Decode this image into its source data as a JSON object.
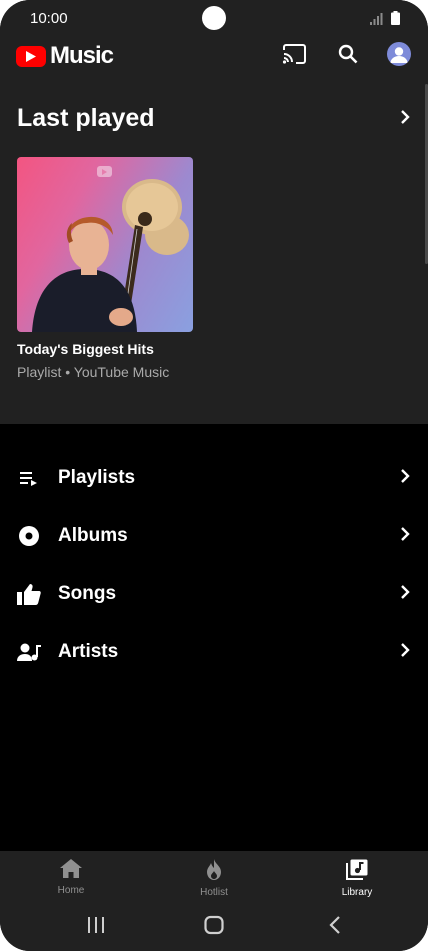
{
  "status_bar": {
    "time": "10:00"
  },
  "app": {
    "name": "Music"
  },
  "last_played": {
    "title": "Last played",
    "card": {
      "title": "Today's Biggest Hits",
      "subtitle": "Playlist • YouTube Music"
    }
  },
  "library": {
    "items": [
      {
        "label": "Playlists",
        "icon": "playlist-icon"
      },
      {
        "label": "Albums",
        "icon": "album-icon"
      },
      {
        "label": "Songs",
        "icon": "thumbs-up-icon"
      },
      {
        "label": "Artists",
        "icon": "artist-icon"
      }
    ]
  },
  "bottom_nav": {
    "items": [
      {
        "label": "Home",
        "icon": "home-icon",
        "active": false
      },
      {
        "label": "Hotlist",
        "icon": "flame-icon",
        "active": false
      },
      {
        "label": "Library",
        "icon": "library-icon",
        "active": true
      }
    ]
  },
  "colors": {
    "surface": "#212121",
    "background": "#000000",
    "brand_red": "#ff0000",
    "secondary_text": "#aaaaaa",
    "inactive_nav": "#909090"
  }
}
